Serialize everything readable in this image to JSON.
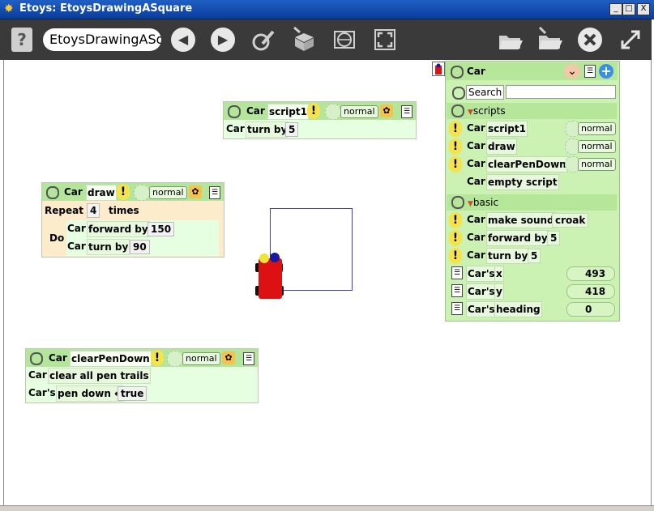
{
  "window": {
    "title": "Etoys: EtoysDrawingASquare",
    "controls": [
      "_",
      "□",
      "X"
    ]
  },
  "toolbar": {
    "help_label": "?",
    "project_name": "EtoysDrawingASqua",
    "back_icon": "◀",
    "forward_icon": "▶"
  },
  "scripts": [
    {
      "object": "Car",
      "name": "script1",
      "mode": "normal",
      "lines": [
        {
          "subject": "Car",
          "command": "turn by",
          "value": "5"
        }
      ]
    },
    {
      "object": "Car",
      "name": "draw",
      "mode": "normal",
      "repeat_label": "Repeat",
      "repeat_count": "4",
      "times_label": "times",
      "do_label": "Do",
      "lines": [
        {
          "subject": "Car",
          "command": "forward by",
          "value": "150"
        },
        {
          "subject": "Car",
          "command": "turn by",
          "value": "90"
        }
      ]
    },
    {
      "object": "Car",
      "name": "clearPenDown",
      "mode": "normal",
      "lines": [
        {
          "subject": "Car",
          "command": "clear all pen trails"
        },
        {
          "subject": "Car's",
          "command": "pen down ←",
          "value": "true"
        }
      ]
    }
  ],
  "viewer": {
    "title": "Car",
    "search_label": "Search",
    "search_value": "",
    "scripts_section": "scripts",
    "script_rows": [
      {
        "subject": "Car",
        "name": "script1",
        "mode": "normal"
      },
      {
        "subject": "Car",
        "name": "draw",
        "mode": "normal"
      },
      {
        "subject": "Car",
        "name": "clearPenDown",
        "mode": "normal"
      },
      {
        "subject": "Car",
        "name": "empty script"
      }
    ],
    "basic_section": "basic",
    "basic_rows": [
      {
        "subject": "Car",
        "command": "make sound",
        "value": "croak"
      },
      {
        "subject": "Car",
        "command": "forward by",
        "value": "5"
      },
      {
        "subject": "Car",
        "command": "turn by",
        "value": "5"
      }
    ],
    "property_rows": [
      {
        "subject": "Car's",
        "name": "x",
        "value": "493"
      },
      {
        "subject": "Car's",
        "name": "y",
        "value": "418"
      },
      {
        "subject": "Car's",
        "name": "heading",
        "value": "0"
      }
    ]
  },
  "colors": {
    "toolbar": "#3a3a3a",
    "titlebar": "#1f5fc4",
    "viewer_bg": "#ccf2b3",
    "script_header": "#b3e69a",
    "car_body": "#dd1111",
    "pen_trail": "#3b3bc7"
  }
}
